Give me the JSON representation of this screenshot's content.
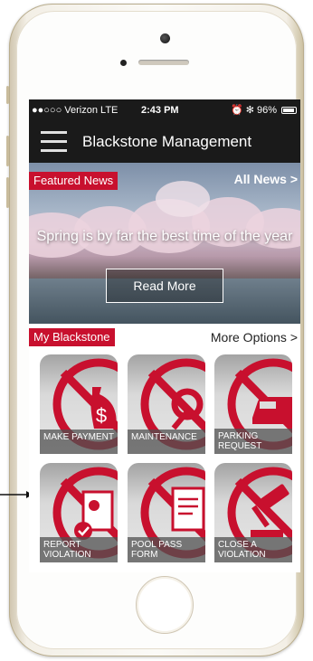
{
  "status_bar": {
    "carrier": "●●○○○ Verizon  LTE",
    "time": "2:43 PM",
    "indicators": "⏰ ✻ 96%"
  },
  "nav": {
    "title": "Blackstone Management",
    "menu_icon": "hamburger-icon"
  },
  "featured": {
    "tag": "Featured News",
    "all_news": "All News >",
    "headline": "Spring is by far the best time of the year",
    "read_more": "Read More"
  },
  "my_blackstone": {
    "tag": "My Blackstone",
    "more_options": "More Options >",
    "tiles": [
      {
        "label": "MAKE PAYMENT",
        "icon": "money-bag-icon"
      },
      {
        "label": "MAINTENANCE",
        "icon": "gear-wrench-icon"
      },
      {
        "label": "PARKING REQUEST",
        "icon": "car-icon"
      },
      {
        "label": "REPORT VIOLATION",
        "icon": "report-icon"
      },
      {
        "label": "POOL PASS FORM",
        "icon": "form-icon"
      },
      {
        "label": "CLOSE A VIOLATION",
        "icon": "gavel-icon"
      }
    ]
  },
  "colors": {
    "brand_red": "#c8102e",
    "nav_bg": "#1a1a1a"
  }
}
